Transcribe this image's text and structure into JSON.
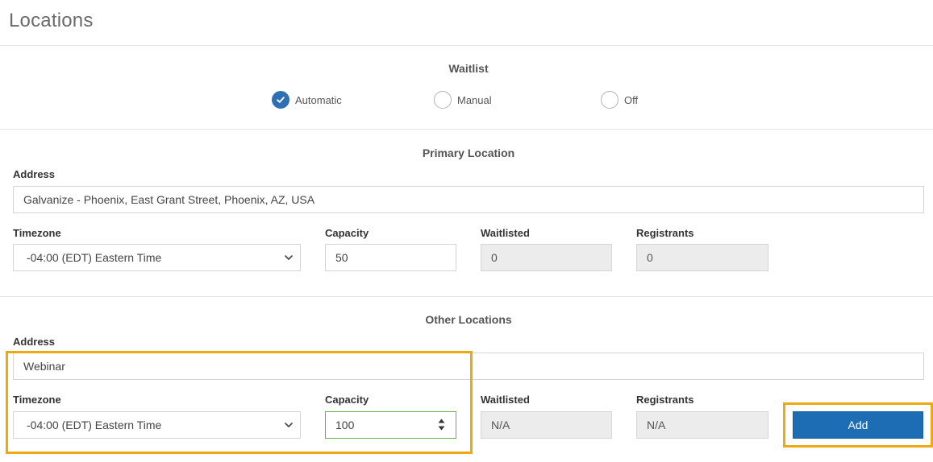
{
  "page": {
    "title": "Locations"
  },
  "waitlist": {
    "title": "Waitlist",
    "options": [
      {
        "label": "Automatic",
        "checked": true
      },
      {
        "label": "Manual",
        "checked": false
      },
      {
        "label": "Off",
        "checked": false
      }
    ]
  },
  "primary_location": {
    "title": "Primary Location",
    "address_label": "Address",
    "address_value": "Galvanize - Phoenix, East Grant Street, Phoenix, AZ, USA",
    "timezone_label": "Timezone",
    "timezone_value": "-04:00 (EDT) Eastern Time",
    "capacity_label": "Capacity",
    "capacity_value": "50",
    "waitlisted_label": "Waitlisted",
    "waitlisted_value": "0",
    "registrants_label": "Registrants",
    "registrants_value": "0"
  },
  "other_locations": {
    "title": "Other Locations",
    "address_label": "Address",
    "address_value": "Webinar",
    "timezone_label": "Timezone",
    "timezone_value": "-04:00 (EDT) Eastern Time",
    "capacity_label": "Capacity",
    "capacity_value": "100",
    "waitlisted_label": "Waitlisted",
    "waitlisted_value": "N/A",
    "registrants_label": "Registrants",
    "registrants_value": "N/A",
    "add_label": "Add"
  },
  "colors": {
    "accent": "#2f70b4",
    "button": "#1d6db4",
    "highlight": "#f0a810",
    "focus": "#63b044"
  },
  "icons": {
    "checkmark": "check-icon",
    "dropdown": "chevron-down-icon",
    "stepper": "stepper-arrows-icon"
  }
}
